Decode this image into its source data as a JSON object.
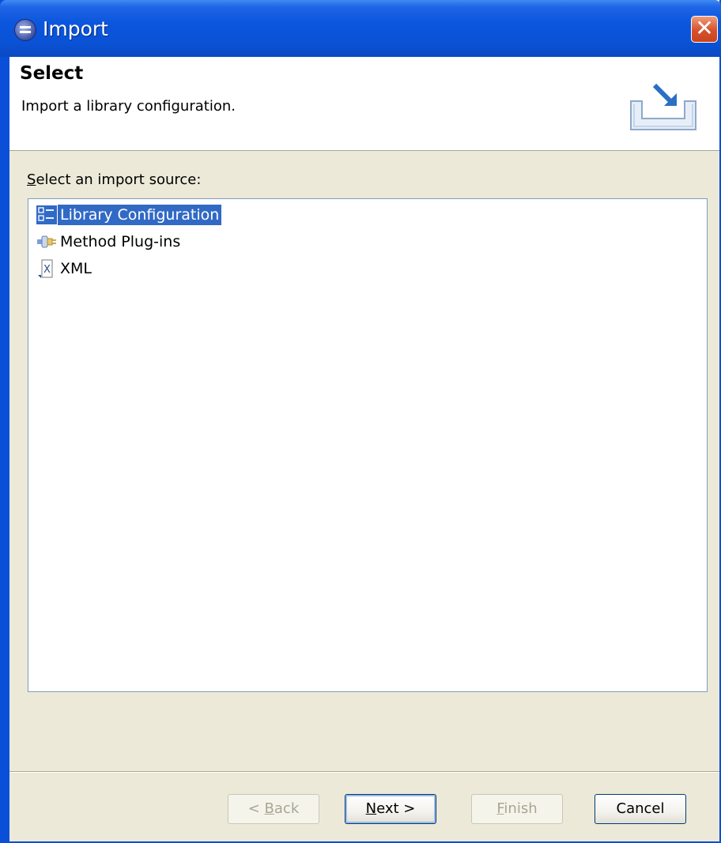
{
  "window": {
    "title": "Import"
  },
  "header": {
    "title": "Select",
    "description": "Import a library configuration."
  },
  "content": {
    "source_label_prefix": "S",
    "source_label_rest": "elect an import source:",
    "items": [
      {
        "label": "Library Configuration",
        "icon": "library-configuration-icon",
        "selected": true
      },
      {
        "label": "Method Plug-ins",
        "icon": "method-plugin-icon",
        "selected": false
      },
      {
        "label": "XML",
        "icon": "xml-file-icon",
        "selected": false
      }
    ]
  },
  "buttons": {
    "back": {
      "prefix": "< ",
      "mnemonic": "B",
      "rest": "ack",
      "enabled": false
    },
    "next": {
      "mnemonic": "N",
      "rest": "ext >",
      "enabled": true
    },
    "finish": {
      "mnemonic": "F",
      "rest": "inish",
      "enabled": false
    },
    "cancel": {
      "label": "Cancel",
      "enabled": true
    }
  },
  "colors": {
    "titlebar": "#0a52d6",
    "selection": "#316ac5",
    "dialog_bg": "#ece9d8"
  }
}
